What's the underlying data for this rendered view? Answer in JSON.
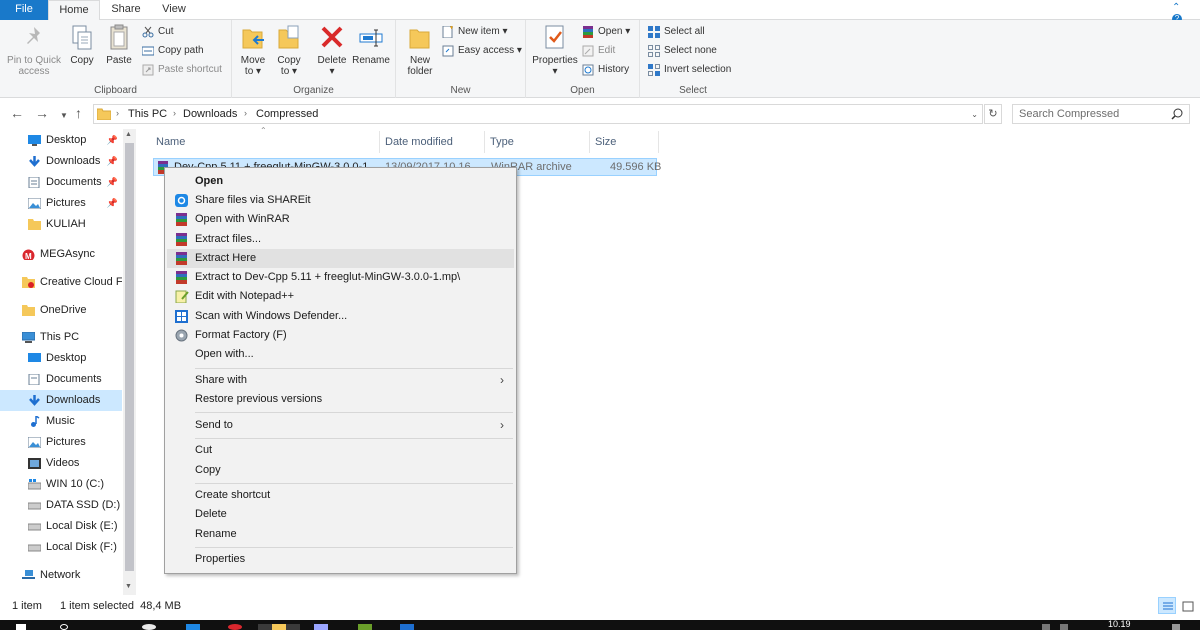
{
  "ribbon_tabs": {
    "file": "File",
    "home": "Home",
    "share": "Share",
    "view": "View"
  },
  "ribbon": {
    "clipboard": {
      "label": "Clipboard",
      "pin_line1": "Pin to Quick",
      "pin_line2": "access",
      "copy": "Copy",
      "paste": "Paste",
      "cut": "Cut",
      "copy_path": "Copy path",
      "paste_shortcut": "Paste shortcut"
    },
    "organize": {
      "label": "Organize",
      "move_line1": "Move",
      "move_line2": "to ▾",
      "copy_line1": "Copy",
      "copy_line2": "to ▾",
      "delete": "Delete",
      "delete_arrow": "▾",
      "rename": "Rename"
    },
    "new": {
      "label": "New",
      "folder_line1": "New",
      "folder_line2": "folder",
      "new_item": "New item ▾",
      "easy_access": "Easy access ▾"
    },
    "open": {
      "label": "Open",
      "properties": "Properties",
      "properties_arrow": "▾",
      "open": "Open ▾",
      "edit": "Edit",
      "history": "History"
    },
    "select": {
      "label": "Select",
      "select_all": "Select all",
      "select_none": "Select none",
      "invert": "Invert selection"
    }
  },
  "address": {
    "crumbs": [
      "This PC",
      "Downloads",
      "Compressed"
    ],
    "search_placeholder": "Search Compressed"
  },
  "nav": {
    "quick": [
      {
        "label": "Desktop"
      },
      {
        "label": "Downloads"
      },
      {
        "label": "Documents"
      },
      {
        "label": "Pictures"
      },
      {
        "label": "KULIAH"
      }
    ],
    "megasync": "MEGAsync",
    "creative_cloud": "Creative Cloud Fil",
    "onedrive": "OneDrive",
    "this_pc": "This PC",
    "pc_items": [
      "Desktop",
      "Documents",
      "Downloads",
      "Music",
      "Pictures",
      "Videos",
      "WIN 10 (C:)",
      "DATA SSD (D:)",
      "Local Disk (E:)",
      "Local Disk (F:)"
    ],
    "network": "Network"
  },
  "columns": {
    "name": "Name",
    "date": "Date modified",
    "type": "Type",
    "size": "Size"
  },
  "file": {
    "name": "Dev-Cpp 5.11 + freeglut-MinGW-3.0.0-1",
    "date": "13/09/2017 10.16",
    "type": "WinRAR archive",
    "size": "49.596 KB"
  },
  "context_menu": {
    "open": "Open",
    "shareit": "Share files via SHAREit",
    "open_winrar": "Open with WinRAR",
    "extract_files": "Extract files...",
    "extract_here": "Extract Here",
    "extract_to": "Extract to Dev-Cpp 5.11 + freeglut-MinGW-3.0.0-1.mp\\",
    "notepad": "Edit with Notepad++",
    "defender": "Scan with Windows Defender...",
    "format_factory": "Format Factory (F)",
    "open_with": "Open with...",
    "share_with": "Share with",
    "restore": "Restore previous versions",
    "send_to": "Send to",
    "cut": "Cut",
    "copy": "Copy",
    "create_shortcut": "Create shortcut",
    "delete": "Delete",
    "rename": "Rename",
    "properties": "Properties"
  },
  "status": {
    "count": "1 item",
    "selected": "1 item selected  48,4 MB"
  },
  "taskbar": {
    "time": "10.19"
  },
  "colors": {
    "accent": "#1979ca",
    "selection": "#cce8ff",
    "selection_border": "#99d1ff",
    "menu_bg": "#f2f2f2"
  }
}
